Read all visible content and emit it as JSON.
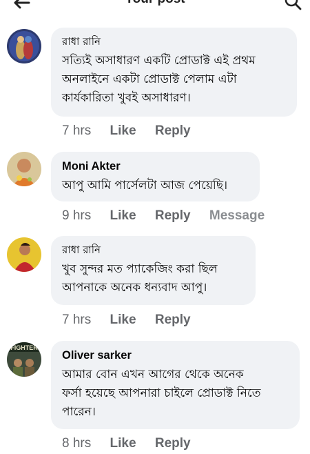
{
  "header": {
    "title": "Your post"
  },
  "comments": [
    {
      "author": "রাধা রানি",
      "text": "সত্যিই অসাধারণ একটি প্রোডাক্ট এই প্রথম\nঅনলাইনে একটা প্রোডাক্ট পেলাম এটা\nকার্যকারিতা খুবই অসাধারণ।",
      "time": "7 hrs",
      "like": "Like",
      "reply": "Reply"
    },
    {
      "author": "Moni Akter",
      "text": "আপু আমি পার্সেলটা আজ পেয়েছি।",
      "time": "9 hrs",
      "like": "Like",
      "reply": "Reply",
      "message": "Message"
    },
    {
      "author": "রাধা রানি",
      "text": "খুব সুন্দর মত প্যাকেজিং করা ছিল\nআপনাকে অনেক ধন্যবাদ আপু।",
      "time": "7 hrs",
      "like": "Like",
      "reply": "Reply"
    },
    {
      "author": "Oliver sarker",
      "text": "আমার বোন এখন আগের থেকে অনেক\nফর্সা হয়েছে আপনারা চাইলে প্রোডাক্ট নিতে\nপারেন।",
      "time": "8 hrs",
      "like": "Like",
      "reply": "Reply",
      "avatar_text": "FIGHTER"
    }
  ]
}
